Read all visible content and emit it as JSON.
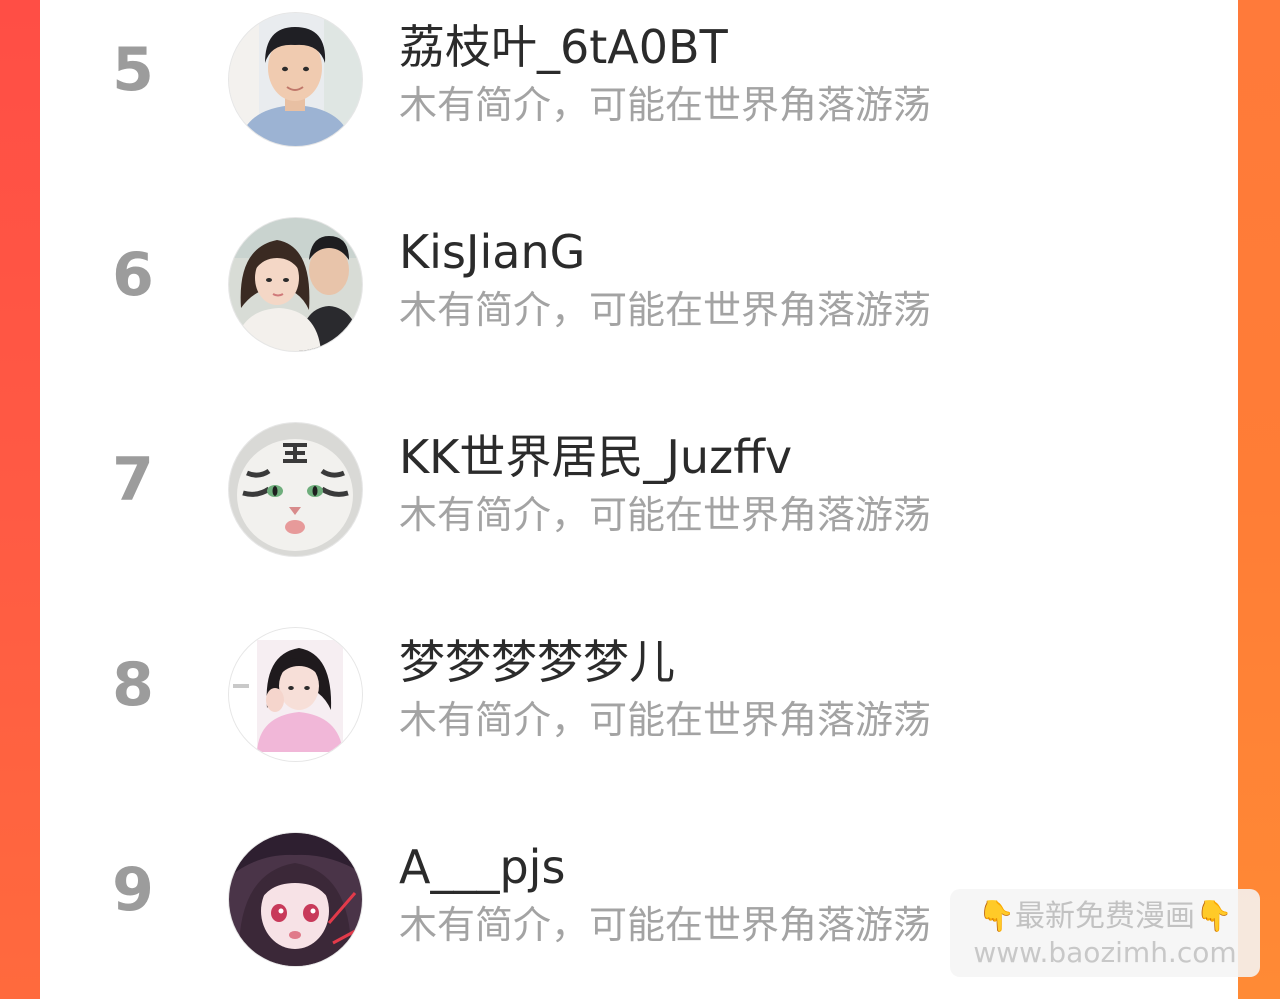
{
  "users": [
    {
      "rank": "5",
      "name": "荔枝叶_6tA0BT",
      "bio": "木有简介，可能在世界角落游荡",
      "avatar": "user-avatar-photo"
    },
    {
      "rank": "6",
      "name": "KisJianG",
      "bio": "木有简介，可能在世界角落游荡",
      "avatar": "couple-avatar-photo"
    },
    {
      "rank": "7",
      "name": "KK世界居民_Juzffv",
      "bio": "木有简介，可能在世界角落游荡",
      "avatar": "tiger-cat-avatar"
    },
    {
      "rank": "8",
      "name": "梦梦梦梦梦儿",
      "bio": "木有简介，可能在世界角落游荡",
      "avatar": "girl-pink-sweater-avatar"
    },
    {
      "rank": "9",
      "name": "A___pjs",
      "bio": "木有简介，可能在世界角落游荡",
      "avatar": "anime-girl-avatar"
    }
  ],
  "watermark": {
    "hand_icon": "👇",
    "line1": "最新免费漫画",
    "line2": "www.baozimh.com"
  },
  "colors": {
    "left_border": "#ff4e45",
    "right_border": "#ff7d36",
    "rank": "#9c9c9c",
    "name": "#2b2b2b",
    "bio": "#a3a3a3"
  }
}
